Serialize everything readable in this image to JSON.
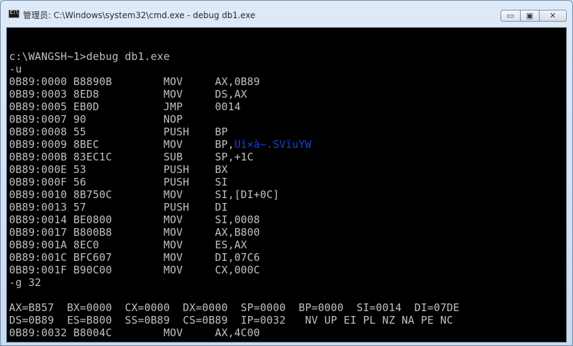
{
  "window": {
    "title": "管理员: C:\\Windows\\system32\\cmd.exe - debug  db1.exe",
    "minimize_glyph": "▭",
    "maximize_glyph": "▣",
    "close_glyph": "✕",
    "icon": "cmd-icon"
  },
  "console": {
    "lines": [
      "",
      "c:\\WANGSH~1>debug db1.exe",
      "-u",
      "0B89:0000 B8890B        MOV     AX,0B89",
      "0B89:0003 8ED8          MOV     DS,AX",
      "0B89:0005 EB0D          JMP     0014",
      "0B89:0007 90            NOP",
      "0B89:0008 55            PUSH    BP",
      "0B89:0009 8BEC          MOV     BP,",
      "0B89:000B 83EC1C        SUB     SP,+1C",
      "0B89:000E 53            PUSH    BX",
      "0B89:000F 56            PUSH    SI",
      "0B89:0010 8B750C        MOV     SI,[DI+0C]",
      "0B89:0013 57            PUSH    DI",
      "0B89:0014 BE0800        MOV     SI,0008",
      "0B89:0017 B800B8        MOV     AX,B800",
      "0B89:001A 8EC0          MOV     ES,AX",
      "0B89:001C BFC607        MOV     DI,07C6",
      "0B89:001F B90C00        MOV     CX,000C",
      "-g 32",
      "",
      "AX=B857  BX=0000  CX=0000  DX=0000  SP=0000  BP=0000  SI=0014  DI=07DE",
      "DS=0B89  ES=B800  SS=0B89  CS=0B89  IP=0032   NV UP EI PL NZ NA PE NC",
      "0B89:0032 B8004C        MOV     AX,4C00",
      ""
    ],
    "overlay_text": "Uï×à~.SVïuYW",
    "text_color": "#c0c0c0",
    "background": "#000000"
  }
}
